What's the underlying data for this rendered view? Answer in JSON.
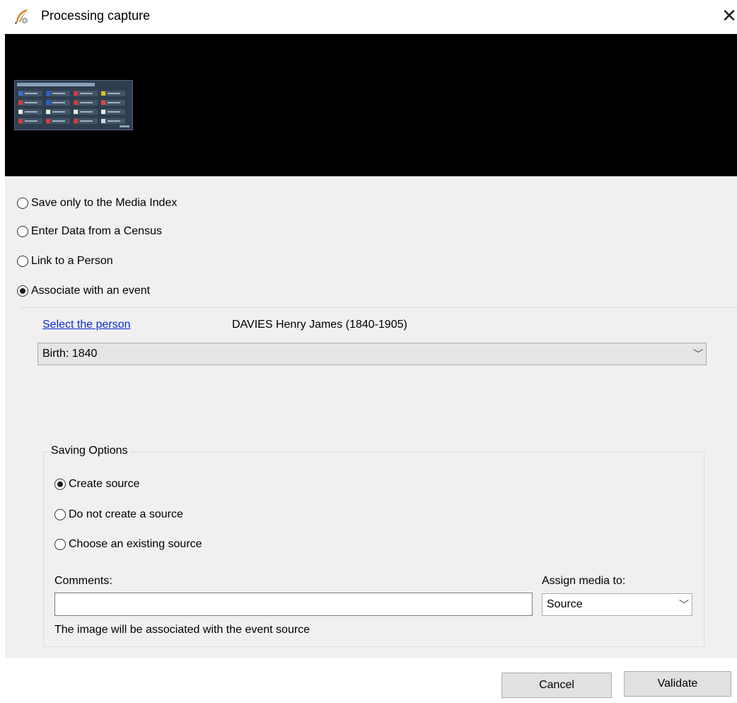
{
  "window": {
    "title": "Processing capture",
    "icon": "feather-quill-icon",
    "close_icon": "close-icon"
  },
  "mode_options": [
    {
      "label": "Save only to the Media Index",
      "checked": false
    },
    {
      "label": "Enter Data from a Census",
      "checked": false
    },
    {
      "label": "Link to a Person",
      "checked": false
    },
    {
      "label": "Associate with an event",
      "checked": true
    }
  ],
  "event": {
    "select_person_link": "Select the person",
    "person_name": "DAVIES Henry James (1840-1905)",
    "event_selected": "Birth: 1840"
  },
  "saving_options": {
    "legend": "Saving Options",
    "options": [
      {
        "label": "Create source",
        "checked": true
      },
      {
        "label": "Do not create a source",
        "checked": false
      },
      {
        "label": "Choose an existing source",
        "checked": false
      }
    ],
    "comments_label": "Comments:",
    "comments_value": "",
    "assign_label": "Assign media to:",
    "assign_value": "Source",
    "hint": "The image will be associated with the event source"
  },
  "buttons": {
    "cancel": "Cancel",
    "validate": "Validate"
  },
  "colors": {
    "link": "#0a2bd8",
    "panel_bg": "#f0f0f0",
    "preview_bg": "#000000"
  }
}
